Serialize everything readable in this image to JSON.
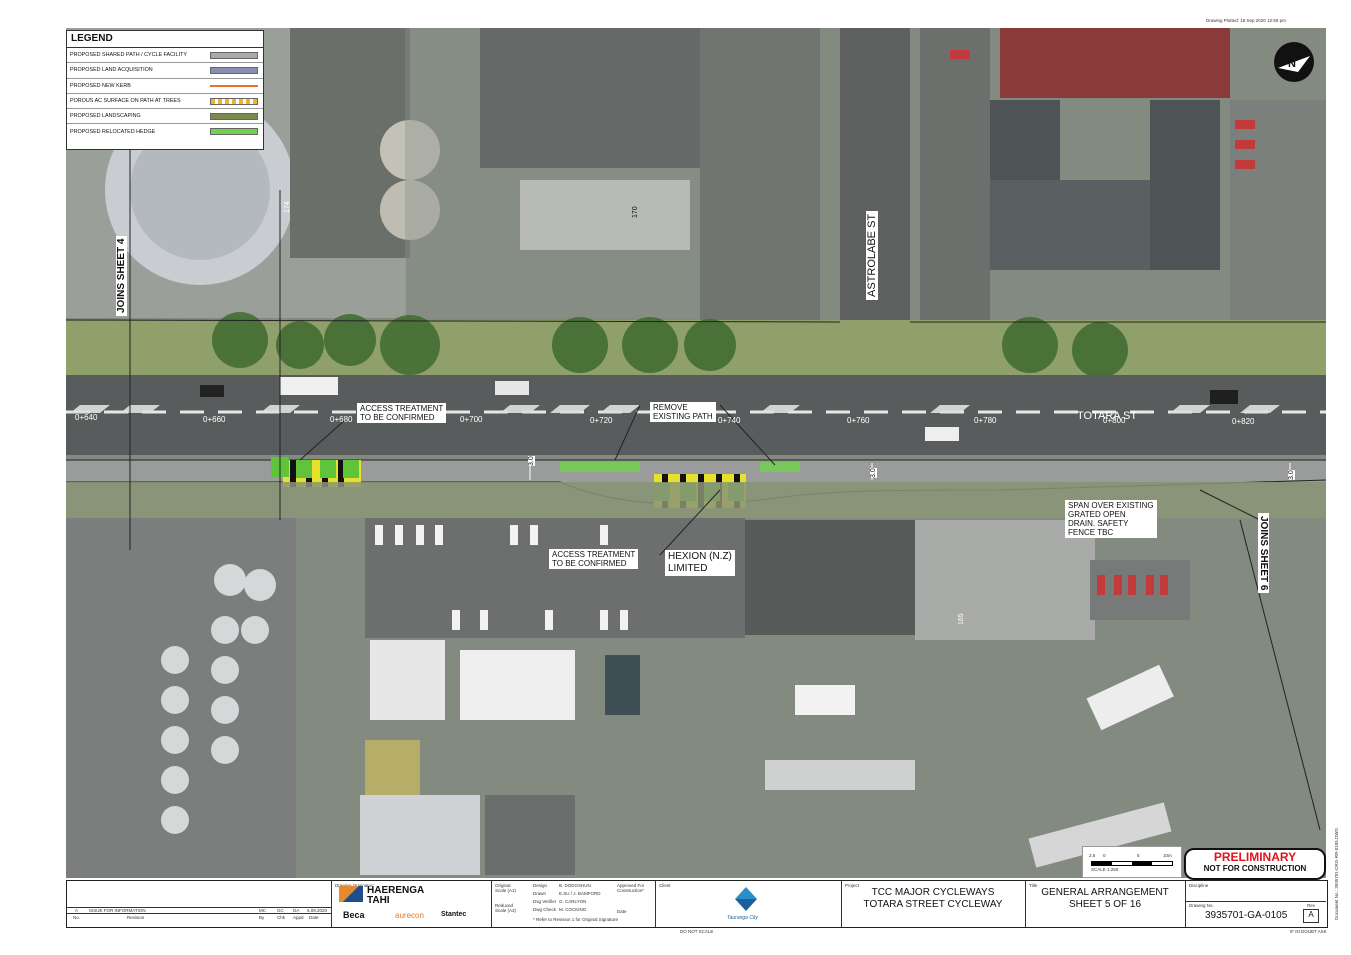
{
  "drawing_plotted": {
    "label": "Drawing Plotted:",
    "value": "18 Sep 2020  12:59 pm"
  },
  "legend": {
    "title": "LEGEND",
    "items": [
      {
        "label": "PROPOSED SHARED PATH / CYCLE FACILITY",
        "swatch": "#a9a9a9"
      },
      {
        "label": "PROPOSED LAND ACQUISITION",
        "swatch": "#8a8fb0"
      },
      {
        "label": "PROPOSED NEW KERB",
        "swatch": "#e8702a"
      },
      {
        "label": "POROUS AC SURFACE ON PATH AT TREES",
        "swatch": "#f0b030"
      },
      {
        "label": "PROPOSED LANDSCAPING",
        "swatch": "#7a8a4a"
      },
      {
        "label": "PROPOSED RELOCATED HEDGE",
        "swatch": "#6fd24a"
      }
    ]
  },
  "streets": {
    "astrolabe": "ASTROLABE ST",
    "totara": "TOTARA ST"
  },
  "chainages": [
    "0+640",
    "0+660",
    "0+680",
    "0+700",
    "0+720",
    "0+740",
    "0+760",
    "0+780",
    "0+800",
    "0+820"
  ],
  "widths": [
    "3.0",
    "3.0",
    "3.0"
  ],
  "callouts": {
    "access_top": "ACCESS TREATMENT\nTO BE CONFIRMED",
    "remove_path": "REMOVE\nEXISTING PATH",
    "access_bottom": "ACCESS TREATMENT\nTO BE CONFIRMED",
    "hexion": "HEXION (N.Z)\nLIMITED",
    "span": "SPAN OVER EXISTING\nGRATED OPEN\nDRAIN. SAFETY\nFENCE TBC"
  },
  "joins": {
    "left": "JOINS SHEET 4",
    "right": "JOINS SHEET 6"
  },
  "building_numbers": [
    "174",
    "170",
    "165"
  ],
  "north_label": "N",
  "scale": {
    "ticks": [
      "2.5",
      "0",
      "5",
      "10m"
    ],
    "label": "SCALE 1:250"
  },
  "stamp": {
    "line1": "PRELIMINARY",
    "line2": "NOT FOR CONSTRUCTION"
  },
  "title_block": {
    "revision": {
      "letter": "A",
      "text": "ISSUE FOR INFORMATION",
      "by": "MC",
      "chk": "GC",
      "appd": "DA",
      "date": "6.09.2020",
      "col_no": "No.",
      "col_rev": "Revision",
      "col_by": "By",
      "col_chk": "Chk",
      "col_appd": "Appd",
      "col_date": "Date"
    },
    "originator_label": "Drawing Originator:",
    "logos": {
      "haerenga1": "HAERENGA",
      "haerenga2": "TAHI",
      "beca": "Beca",
      "aurecon": "aurecon",
      "stantec": "Stantec"
    },
    "scales": {
      "original": "Original\nScale (A1)",
      "reduced": "Reduced\nScale (A3)"
    },
    "people": [
      {
        "role": "Design",
        "name": "B. DODGSHUN"
      },
      {
        "role": "Drawn",
        "name": "E.SU / J. BAMFORD"
      },
      {
        "role": "Dsg Verifier",
        "name": "G. CARLYON"
      },
      {
        "role": "Dwg Check",
        "name": "M. COCKING"
      }
    ],
    "approved": "Approved For\nConstruction*",
    "approved_date": "Date",
    "note": "* Refer to Revision 1 for Original Signature",
    "client_label": "Client",
    "client_name": "Tauranga City",
    "project_label": "Project",
    "project_line1": "TCC MAJOR CYCLEWAYS",
    "project_line2": "TOTARA STREET CYCLEWAY",
    "title_label": "Title",
    "title_line1": "GENERAL ARRANGEMENT",
    "title_line2": "SHEET 5 OF 16",
    "discipline_label": "Discipline",
    "drawing_no_label": "Drawing No.",
    "drawing_no": "3935701-GA-0105",
    "rev_label": "Rev",
    "rev": "A"
  },
  "footer": {
    "do_not_scale": "DO NOT SCALE",
    "if_in_doubt": "IF IN DOUBT ASK"
  },
  "document_no": "Document No.: 3935701-DRG-RR-0105.DWG"
}
